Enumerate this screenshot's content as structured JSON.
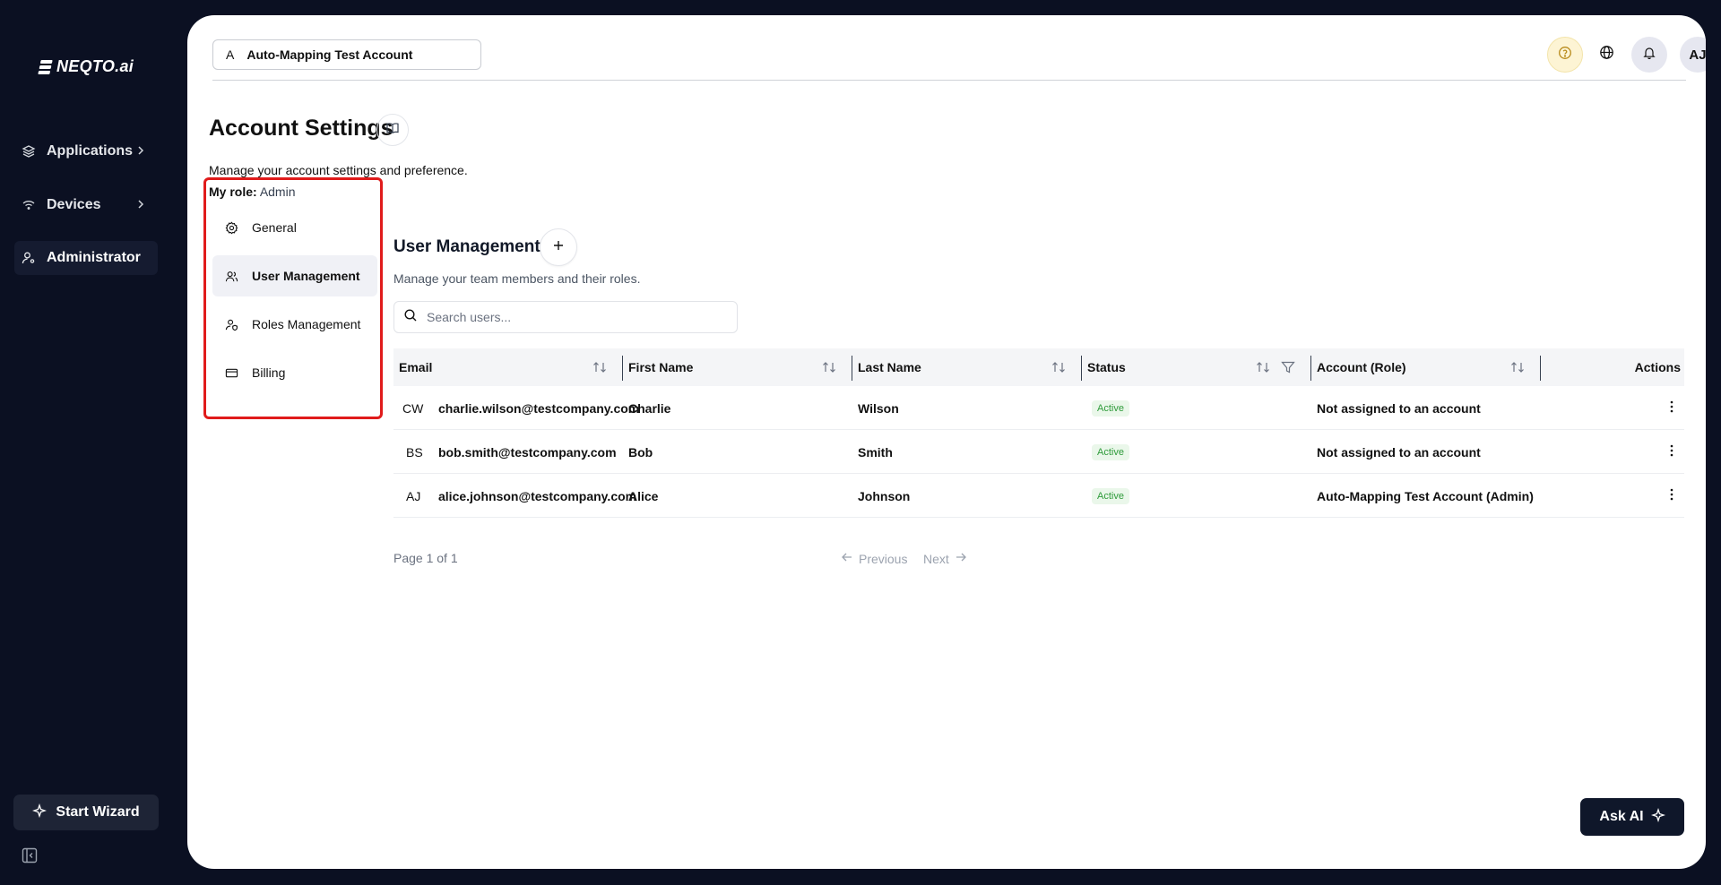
{
  "app": {
    "brand": "NEQTO.ai"
  },
  "sidebar": {
    "items": [
      {
        "label": "Applications",
        "icon": "layers-icon",
        "has_chevron": true
      },
      {
        "label": "Devices",
        "icon": "wifi-icon",
        "has_chevron": true
      },
      {
        "label": "Administrator",
        "icon": "user-cog-icon",
        "active": true
      }
    ],
    "wizard_label": "Start Wizard"
  },
  "topbar": {
    "account_letter": "A",
    "account_name": "Auto-Mapping Test Account",
    "avatar_initials": "AJ"
  },
  "page": {
    "title": "Account Settings",
    "subtitle": "Manage your account settings and preference.",
    "role_label": "My role:",
    "role_value": "Admin"
  },
  "settings_nav": [
    {
      "label": "General",
      "icon": "gear-icon"
    },
    {
      "label": "User Management",
      "icon": "users-icon",
      "active": true
    },
    {
      "label": "Roles Management",
      "icon": "user-shield-icon"
    },
    {
      "label": "Billing",
      "icon": "credit-card-icon"
    }
  ],
  "user_management": {
    "title": "User Management",
    "subtitle": "Manage your team members and their roles.",
    "search_placeholder": "Search users...",
    "columns": [
      "Email",
      "First Name",
      "Last Name",
      "Status",
      "Account (Role)",
      "Actions"
    ],
    "rows": [
      {
        "initials": "CW",
        "email": "charlie.wilson@testcompany.com",
        "first": "Charlie",
        "last": "Wilson",
        "status": "Active",
        "account": "Not assigned to an account"
      },
      {
        "initials": "BS",
        "email": "bob.smith@testcompany.com",
        "first": "Bob",
        "last": "Smith",
        "status": "Active",
        "account": "Not assigned to an account"
      },
      {
        "initials": "AJ",
        "email": "alice.johnson@testcompany.com",
        "first": "Alice",
        "last": "Johnson",
        "status": "Active",
        "account": "Auto-Mapping Test Account (Admin)"
      }
    ],
    "pager": {
      "text": "Page 1 of 1",
      "previous": "Previous",
      "next": "Next"
    }
  },
  "ask_ai": "Ask AI",
  "colors": {
    "sidebar_bg": "#0b1022",
    "active_badge_bg": "#eaf7ea",
    "active_badge_text": "#2e9b3a",
    "highlight_border": "#e01b1b",
    "help_bg": "#fdf4d4"
  }
}
